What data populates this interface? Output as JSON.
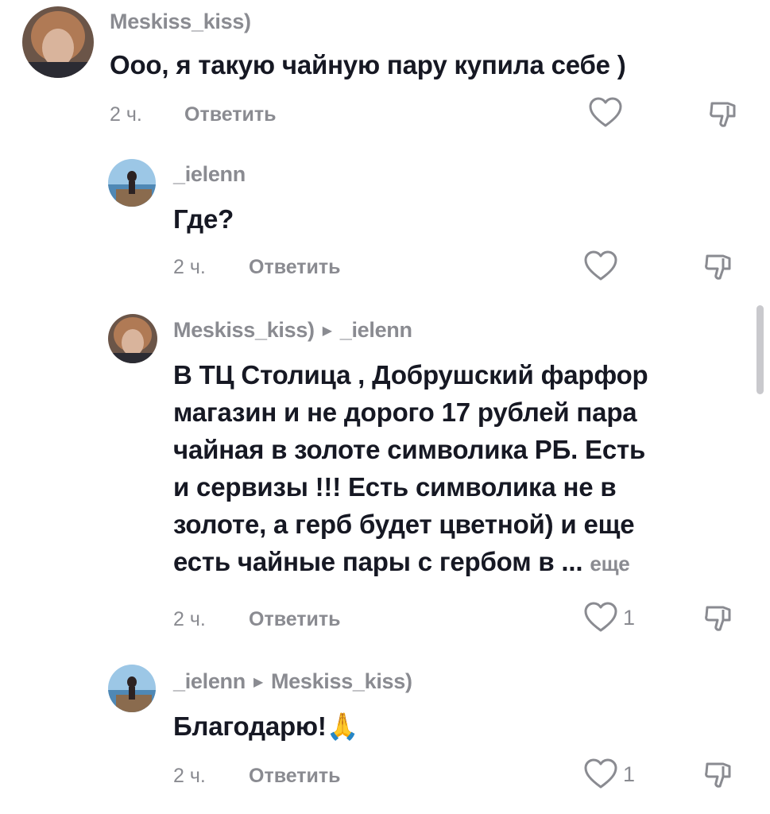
{
  "comments": [
    {
      "username": "Meskiss_kiss)",
      "reply_to": "",
      "text": "Ооо, я такую чайную пару купила себе )",
      "time": "2 ч.",
      "reply_label": "Ответить",
      "likes": ""
    },
    {
      "username": "_ielenn",
      "reply_to": "",
      "text": "Где?",
      "time": "2 ч.",
      "reply_label": "Ответить",
      "likes": ""
    },
    {
      "username": "Meskiss_kiss)",
      "reply_to": "_ielenn",
      "text_lines": [
        "В ТЦ Столица , Добрушский фарфор",
        "магазин и не дорого 17 рублей пара",
        "чайная в золоте символика РБ. Есть",
        "и сервизы !!! Есть символика не в",
        "золоте, а герб будет цветной) и еще",
        "есть чайные пары с гербом в ..."
      ],
      "more_label": "еще",
      "time": "2 ч.",
      "reply_label": "Ответить",
      "likes": "1"
    },
    {
      "username": "_ielenn",
      "reply_to": "Meskiss_kiss)",
      "text": "Благодарю!",
      "emoji": "🙏",
      "time": "2 ч.",
      "reply_label": "Ответить",
      "likes": "1"
    }
  ],
  "icons": {
    "like": "heart-outline-icon",
    "dislike": "thumbs-down-icon",
    "reply_arrow": "caret-right-icon"
  },
  "colors": {
    "text": "#161823",
    "secondary": "#8a8b91"
  }
}
